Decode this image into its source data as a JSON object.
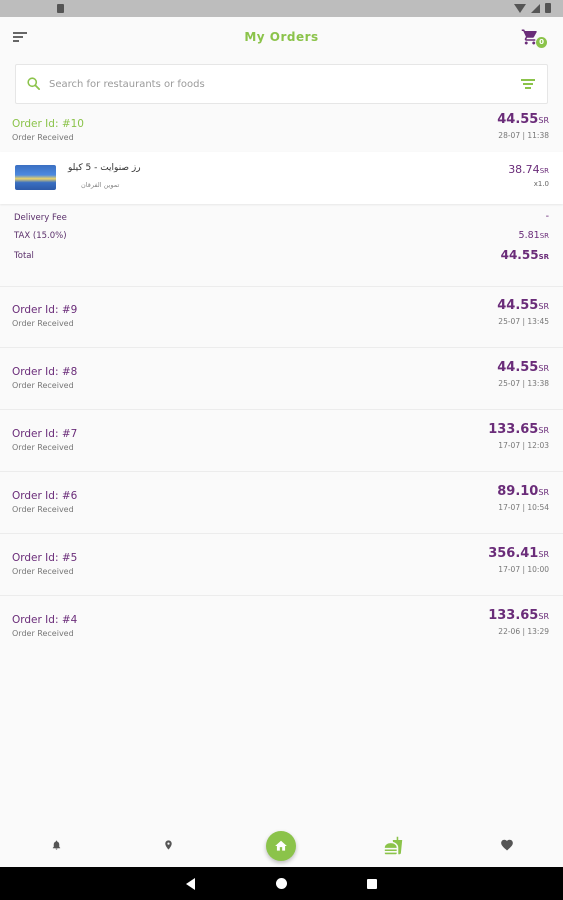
{
  "app": {
    "title": "My Orders",
    "cart_count": "0"
  },
  "search": {
    "placeholder": "Search for restaurants or foods"
  },
  "expanded_order": {
    "id_label": "Order Id: #10",
    "status": "Order Received",
    "price": "44.55",
    "currency": "SR",
    "date": "28-07 | 11:38",
    "item": {
      "name": "رز صنوايت - 5 كيلو",
      "vendor": "تموين الفرقان",
      "price": "38.74",
      "currency": "SR",
      "qty": "x1.0"
    },
    "summary": {
      "delivery_label": "Delivery Fee",
      "delivery_value": "-",
      "tax_label": "TAX (15.0%)",
      "tax_value": "5.81",
      "total_label": "Total",
      "total_value": "44.55",
      "currency": "SR"
    }
  },
  "orders": [
    {
      "id_label": "Order Id: #9",
      "status": "Order Received",
      "price": "44.55",
      "currency": "SR",
      "date": "25-07 | 13:45"
    },
    {
      "id_label": "Order Id: #8",
      "status": "Order Received",
      "price": "44.55",
      "currency": "SR",
      "date": "25-07 | 13:38"
    },
    {
      "id_label": "Order Id: #7",
      "status": "Order Received",
      "price": "133.65",
      "currency": "SR",
      "date": "17-07 | 12:03"
    },
    {
      "id_label": "Order Id: #6",
      "status": "Order Received",
      "price": "89.10",
      "currency": "SR",
      "date": "17-07 | 10:54"
    },
    {
      "id_label": "Order Id: #5",
      "status": "Order Received",
      "price": "356.41",
      "currency": "SR",
      "date": "17-07 | 10:00"
    },
    {
      "id_label": "Order Id: #4",
      "status": "Order Received",
      "price": "133.65",
      "currency": "SR",
      "date": "22-06 | 13:29"
    }
  ],
  "colors": {
    "accent": "#8bc34a",
    "primary": "#6a2c79"
  },
  "icons": {
    "bottom_nav": [
      "bell-icon",
      "location-pin-icon",
      "home-icon",
      "fastfood-icon",
      "heart-icon"
    ]
  }
}
